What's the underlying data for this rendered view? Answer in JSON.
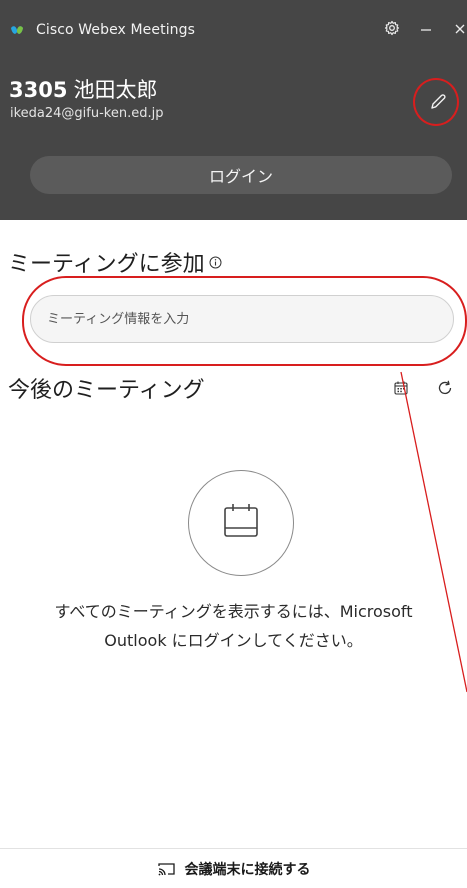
{
  "window": {
    "title": "Cisco Webex Meetings",
    "settings_icon": "gear-icon",
    "minimize_icon": "minimize-icon",
    "close_icon": "close-icon"
  },
  "user": {
    "id": "3305",
    "name": "池田太郎",
    "email": "ikeda24@gifu-ken.ed.jp",
    "edit_icon": "pencil-icon"
  },
  "header": {
    "login_label": "ログイン",
    "background_color": "#464646"
  },
  "join": {
    "label": "ミーティングに参加",
    "info_icon": "info-icon",
    "input_placeholder": "ミーティング情報を入力",
    "input_value": ""
  },
  "upcoming": {
    "label": "今後のミーティング",
    "calendar_icon": "calendar-icon",
    "refresh_icon": "refresh-icon",
    "empty_line1": "すべてのミーティングを表示するには、Microsoft",
    "empty_line2": "Outlook にログインしてください。"
  },
  "footer": {
    "connect_label": "会議端末に接続する",
    "cast_icon": "cast-icon"
  },
  "annotation_color": "#d81e1e"
}
